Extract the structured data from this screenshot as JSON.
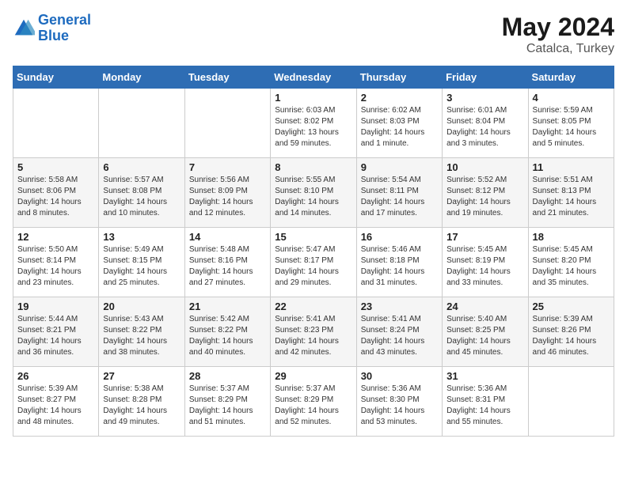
{
  "header": {
    "logo_line1": "General",
    "logo_line2": "Blue",
    "month_year": "May 2024",
    "location": "Catalca, Turkey"
  },
  "days_of_week": [
    "Sunday",
    "Monday",
    "Tuesday",
    "Wednesday",
    "Thursday",
    "Friday",
    "Saturday"
  ],
  "weeks": [
    [
      {
        "day": "",
        "content": ""
      },
      {
        "day": "",
        "content": ""
      },
      {
        "day": "",
        "content": ""
      },
      {
        "day": "1",
        "content": "Sunrise: 6:03 AM\nSunset: 8:02 PM\nDaylight: 13 hours and 59 minutes."
      },
      {
        "day": "2",
        "content": "Sunrise: 6:02 AM\nSunset: 8:03 PM\nDaylight: 14 hours and 1 minute."
      },
      {
        "day": "3",
        "content": "Sunrise: 6:01 AM\nSunset: 8:04 PM\nDaylight: 14 hours and 3 minutes."
      },
      {
        "day": "4",
        "content": "Sunrise: 5:59 AM\nSunset: 8:05 PM\nDaylight: 14 hours and 5 minutes."
      }
    ],
    [
      {
        "day": "5",
        "content": "Sunrise: 5:58 AM\nSunset: 8:06 PM\nDaylight: 14 hours and 8 minutes."
      },
      {
        "day": "6",
        "content": "Sunrise: 5:57 AM\nSunset: 8:08 PM\nDaylight: 14 hours and 10 minutes."
      },
      {
        "day": "7",
        "content": "Sunrise: 5:56 AM\nSunset: 8:09 PM\nDaylight: 14 hours and 12 minutes."
      },
      {
        "day": "8",
        "content": "Sunrise: 5:55 AM\nSunset: 8:10 PM\nDaylight: 14 hours and 14 minutes."
      },
      {
        "day": "9",
        "content": "Sunrise: 5:54 AM\nSunset: 8:11 PM\nDaylight: 14 hours and 17 minutes."
      },
      {
        "day": "10",
        "content": "Sunrise: 5:52 AM\nSunset: 8:12 PM\nDaylight: 14 hours and 19 minutes."
      },
      {
        "day": "11",
        "content": "Sunrise: 5:51 AM\nSunset: 8:13 PM\nDaylight: 14 hours and 21 minutes."
      }
    ],
    [
      {
        "day": "12",
        "content": "Sunrise: 5:50 AM\nSunset: 8:14 PM\nDaylight: 14 hours and 23 minutes."
      },
      {
        "day": "13",
        "content": "Sunrise: 5:49 AM\nSunset: 8:15 PM\nDaylight: 14 hours and 25 minutes."
      },
      {
        "day": "14",
        "content": "Sunrise: 5:48 AM\nSunset: 8:16 PM\nDaylight: 14 hours and 27 minutes."
      },
      {
        "day": "15",
        "content": "Sunrise: 5:47 AM\nSunset: 8:17 PM\nDaylight: 14 hours and 29 minutes."
      },
      {
        "day": "16",
        "content": "Sunrise: 5:46 AM\nSunset: 8:18 PM\nDaylight: 14 hours and 31 minutes."
      },
      {
        "day": "17",
        "content": "Sunrise: 5:45 AM\nSunset: 8:19 PM\nDaylight: 14 hours and 33 minutes."
      },
      {
        "day": "18",
        "content": "Sunrise: 5:45 AM\nSunset: 8:20 PM\nDaylight: 14 hours and 35 minutes."
      }
    ],
    [
      {
        "day": "19",
        "content": "Sunrise: 5:44 AM\nSunset: 8:21 PM\nDaylight: 14 hours and 36 minutes."
      },
      {
        "day": "20",
        "content": "Sunrise: 5:43 AM\nSunset: 8:22 PM\nDaylight: 14 hours and 38 minutes."
      },
      {
        "day": "21",
        "content": "Sunrise: 5:42 AM\nSunset: 8:22 PM\nDaylight: 14 hours and 40 minutes."
      },
      {
        "day": "22",
        "content": "Sunrise: 5:41 AM\nSunset: 8:23 PM\nDaylight: 14 hours and 42 minutes."
      },
      {
        "day": "23",
        "content": "Sunrise: 5:41 AM\nSunset: 8:24 PM\nDaylight: 14 hours and 43 minutes."
      },
      {
        "day": "24",
        "content": "Sunrise: 5:40 AM\nSunset: 8:25 PM\nDaylight: 14 hours and 45 minutes."
      },
      {
        "day": "25",
        "content": "Sunrise: 5:39 AM\nSunset: 8:26 PM\nDaylight: 14 hours and 46 minutes."
      }
    ],
    [
      {
        "day": "26",
        "content": "Sunrise: 5:39 AM\nSunset: 8:27 PM\nDaylight: 14 hours and 48 minutes."
      },
      {
        "day": "27",
        "content": "Sunrise: 5:38 AM\nSunset: 8:28 PM\nDaylight: 14 hours and 49 minutes."
      },
      {
        "day": "28",
        "content": "Sunrise: 5:37 AM\nSunset: 8:29 PM\nDaylight: 14 hours and 51 minutes."
      },
      {
        "day": "29",
        "content": "Sunrise: 5:37 AM\nSunset: 8:29 PM\nDaylight: 14 hours and 52 minutes."
      },
      {
        "day": "30",
        "content": "Sunrise: 5:36 AM\nSunset: 8:30 PM\nDaylight: 14 hours and 53 minutes."
      },
      {
        "day": "31",
        "content": "Sunrise: 5:36 AM\nSunset: 8:31 PM\nDaylight: 14 hours and 55 minutes."
      },
      {
        "day": "",
        "content": ""
      }
    ]
  ]
}
